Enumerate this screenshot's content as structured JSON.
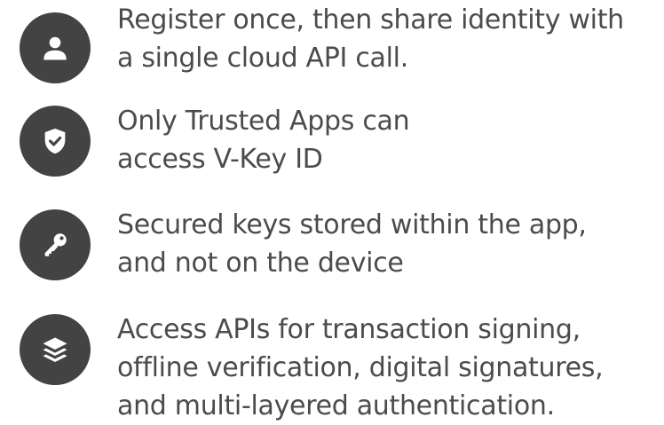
{
  "colors": {
    "icon_circle": "#434343",
    "icon_glyph": "#ffffff",
    "text": "#4b4b4b",
    "background": "#ffffff"
  },
  "features": [
    {
      "icon": "user-icon",
      "lines": [
        "Register once, then share identity with",
        "a single cloud API call."
      ]
    },
    {
      "icon": "shield-check-icon",
      "lines": [
        "Only Trusted Apps can",
        "access V-Key ID"
      ]
    },
    {
      "icon": "key-icon",
      "lines": [
        "Secured keys stored within the app,",
        "and not on the device"
      ]
    },
    {
      "icon": "layers-icon",
      "lines": [
        "Access APIs for transaction signing,",
        "offline verification, digital signatures,",
        "and multi-layered authentication."
      ]
    }
  ]
}
